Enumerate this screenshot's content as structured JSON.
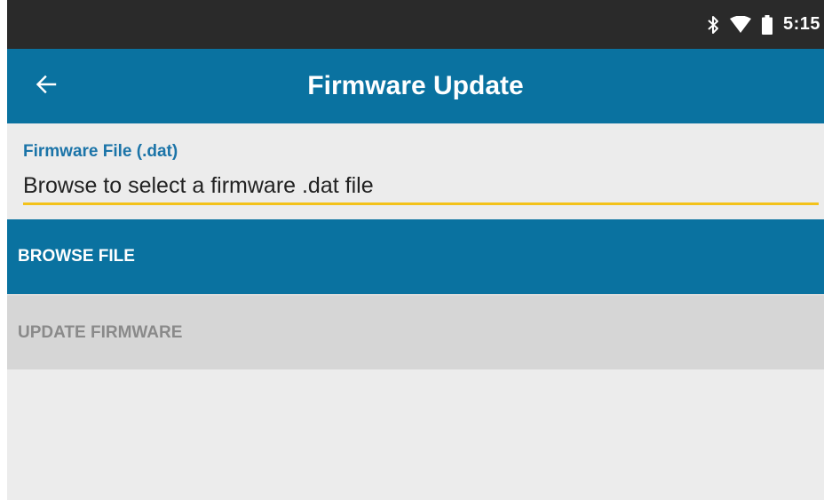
{
  "status_bar": {
    "time": "5:15",
    "icons": [
      "bluetooth-icon",
      "wifi-icon",
      "battery-icon"
    ]
  },
  "app_bar": {
    "title": "Firmware Update",
    "back_icon": "arrow-left-icon"
  },
  "form": {
    "field_label": "Firmware File (.dat)",
    "field_placeholder": "Browse to select a firmware .dat file",
    "field_value": ""
  },
  "buttons": {
    "browse_label": "BROWSE FILE",
    "update_label": "UPDATE FIRMWARE",
    "update_enabled": false
  },
  "colors": {
    "primary": "#0a72a0",
    "accent_underline": "#f3c21a",
    "status_bar": "#2a2a2a",
    "background": "#ececec",
    "disabled_button": "#d6d6d6"
  }
}
